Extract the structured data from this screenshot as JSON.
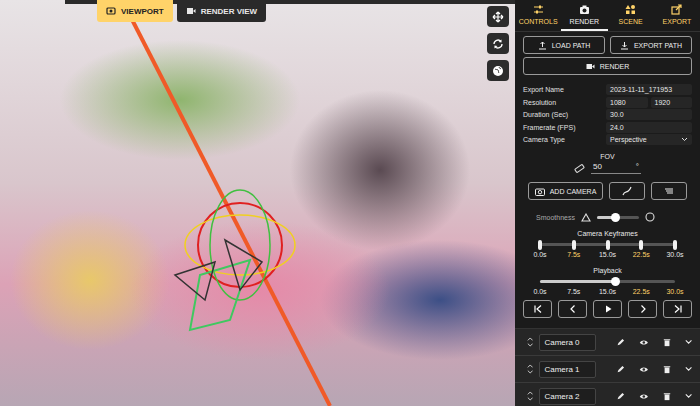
{
  "viewport_tabs": [
    {
      "label": "VIEWPORT",
      "selected": true,
      "kind": "viewport"
    },
    {
      "label": "RENDER VIEW",
      "selected": false,
      "kind": "render"
    }
  ],
  "view_tools": [
    {
      "kind": "move"
    },
    {
      "kind": "rotate"
    },
    {
      "kind": "globe"
    }
  ],
  "panel_tabs": [
    {
      "label": "CONTROLS",
      "selected": false,
      "kind": "controls"
    },
    {
      "label": "RENDER",
      "selected": true,
      "kind": "render"
    },
    {
      "label": "SCENE",
      "selected": false,
      "kind": "scene"
    },
    {
      "label": "EXPORT",
      "selected": false,
      "kind": "export"
    }
  ],
  "path_buttons": [
    {
      "label": "LOAD PATH",
      "kind": "load"
    },
    {
      "label": "EXPORT PATH",
      "kind": "export"
    }
  ],
  "render_button": "RENDER",
  "fields": [
    {
      "label": "Export Name",
      "kind": "text",
      "values": [
        "2023-11-11_171953"
      ]
    },
    {
      "label": "Resolution",
      "kind": "pair",
      "values": [
        "1080",
        "1920"
      ]
    },
    {
      "label": "Duration (Sec)",
      "kind": "text",
      "values": [
        "30.0"
      ]
    },
    {
      "label": "Framerate (FPS)",
      "kind": "text",
      "values": [
        "24.0"
      ]
    },
    {
      "label": "Camera Type",
      "kind": "select",
      "values": [
        "Perspective"
      ]
    }
  ],
  "fov": {
    "label": "FOV",
    "value": "50",
    "unit": "°"
  },
  "add_camera": "ADD CAMERA",
  "smoothness": {
    "label": "Smoothness",
    "level": 0.45
  },
  "keyframes": {
    "title": "Camera Keyframes",
    "handles": [
      0,
      0.25,
      0.5,
      0.75,
      1
    ],
    "marks": [
      {
        "label": "0.0s",
        "highlighted": false
      },
      {
        "label": "7.5s",
        "highlighted": true
      },
      {
        "label": "15.0s",
        "highlighted": false
      },
      {
        "label": "22.5s",
        "highlighted": true
      },
      {
        "label": "30.0s",
        "highlighted": false
      }
    ]
  },
  "playback": {
    "title": "Playback",
    "level": 0.56,
    "marks": [
      {
        "label": "0.0s",
        "highlighted": false
      },
      {
        "label": "7.5s",
        "highlighted": false
      },
      {
        "label": "15.0s",
        "highlighted": false
      },
      {
        "label": "22.5s",
        "highlighted": true
      },
      {
        "label": "30.0s",
        "highlighted": true
      }
    ]
  },
  "transport": [
    {
      "kind": "first"
    },
    {
      "kind": "prev"
    },
    {
      "kind": "play"
    },
    {
      "kind": "next"
    },
    {
      "kind": "last"
    }
  ],
  "cameras": [
    {
      "name": "Camera 0"
    },
    {
      "name": "Camera 1"
    },
    {
      "name": "Camera 2"
    }
  ]
}
